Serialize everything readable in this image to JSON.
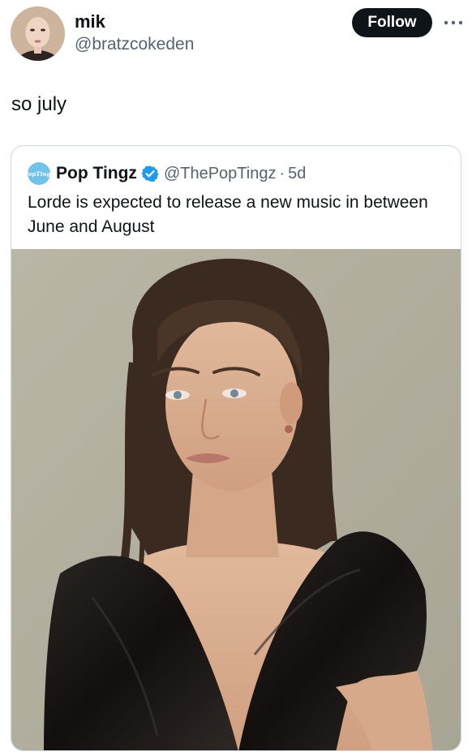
{
  "author": {
    "name": "mik",
    "handle": "@bratzcokeden",
    "avatar_icon": "profile-photo"
  },
  "actions": {
    "follow_label": "Follow",
    "more_icon": "more-dots-icon"
  },
  "tweet": {
    "text": "so july"
  },
  "quoted_tweet": {
    "avatar_icon": "pop-tingz-logo",
    "avatar_logo_text": [
      "Pop",
      "Tingz"
    ],
    "name": "Pop Tingz",
    "verified_icon": "verified-badge-icon",
    "handle": "@ThePopTingz",
    "separator": "·",
    "time": "5d",
    "text": "Lorde is expected to release a new music in between June and August",
    "media_icon": "photo"
  },
  "colors": {
    "follow_bg": "#0f1419",
    "verified": "#1d9bf0",
    "muted_text": "#536471",
    "card_border": "#cfd9de"
  }
}
